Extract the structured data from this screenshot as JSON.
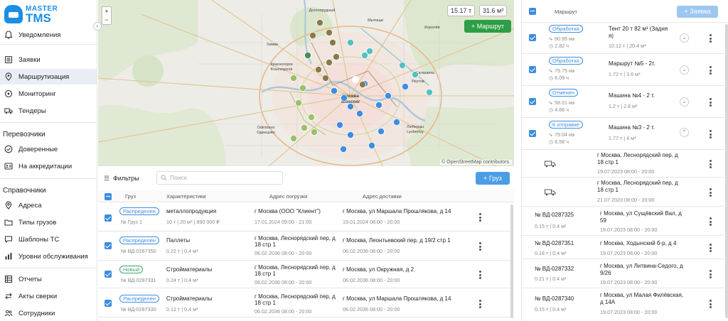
{
  "logo": {
    "line1": "MASTER",
    "line2": "TMS"
  },
  "sidebar": {
    "items": [
      {
        "label": "Уведомления",
        "icon": "bell-icon"
      },
      {
        "label": "Заявки",
        "icon": "list-icon"
      },
      {
        "label": "Маршрутизация",
        "icon": "location-icon"
      },
      {
        "label": "Мониторинг",
        "icon": "target-icon"
      },
      {
        "label": "Тендеры",
        "icon": "truck-icon"
      },
      {
        "label": "Доверенные",
        "icon": "check-circle-icon"
      },
      {
        "label": "На аккредитации",
        "icon": "id-card-icon"
      },
      {
        "label": "Адреса",
        "icon": "pin-icon"
      },
      {
        "label": "Типы грузов",
        "icon": "folder-icon"
      },
      {
        "label": "Шаблоны ТС",
        "icon": "chat-icon"
      },
      {
        "label": "Уровни обслуживания",
        "icon": "bars-icon"
      },
      {
        "label": "Отчеты",
        "icon": "report-icon"
      },
      {
        "label": "Акты сверки",
        "icon": "arrows-icon"
      },
      {
        "label": "Сотрудники",
        "icon": "users-icon"
      }
    ],
    "sections": {
      "carriers": "Перевозчики",
      "references": "Справочники"
    }
  },
  "map": {
    "weight": "15.17 т",
    "volume": "31.6 м³",
    "route_button": "+ Маршрут",
    "zoom_in": "+",
    "zoom_out": "−",
    "attribution": "© OpenStreetMap contributors.",
    "labels": [
      "Долгопрудный",
      "Мытищи",
      "Химки",
      "Королёв",
      "Красногорск",
      "Krasnogorsk",
      "Балашиха",
      "Odintsovo",
      "Одинцово",
      "Люберцы",
      "Lyubertsy",
      "Москва",
      "Moscow",
      "Реутов"
    ]
  },
  "toolbar": {
    "filters": "Фильтры",
    "search_placeholder": "Поиск",
    "add_cargo": "+ Груз"
  },
  "table": {
    "headers": [
      "Груз",
      "Характеристики",
      "Адрес погрузки",
      "Адрес доставки"
    ],
    "rows": [
      {
        "status": "Распределен",
        "id": "№ Груз 1",
        "name": "металлопродукция",
        "specs": "10 т | 20 м³ | 890 000 ₽",
        "load_addr1": "г Москва (ООО \"Клиент\")",
        "load_addr2": "",
        "load_time": "17.01.2024 09:00 - 21:00",
        "del_addr1": "г Москва, ул Маршала Прошлякова, д 14",
        "del_addr2": "",
        "del_time": "19.01.2024 08:00 - 20:00"
      },
      {
        "status": "Распределен",
        "id": "№ ВД-0287350",
        "name": "Паллеты",
        "specs": "0.22 т | 0.4 м³",
        "load_addr1": "г Москва, Леснорядский пер, д",
        "load_addr2": "18 стр 1",
        "load_time": "06.02.2036 08:00 - 20:00",
        "del_addr1": "г Москва, Леонтьевский пер, д 19/2 стр 1",
        "del_addr2": "",
        "del_time": "06.02.2036 08:00 - 20:00"
      },
      {
        "status": "Новый",
        "id": "№ ВД-0287331",
        "name": "Стройматериалы",
        "specs": "0.24 т | 0.4 м³",
        "load_addr1": "г Москва, Леснорядский пер, д",
        "load_addr2": "18 стр 1",
        "load_time": "06.02.2036 08:00 - 20:00",
        "del_addr1": "г Москва, ул Окружная, д 2",
        "del_addr2": "",
        "del_time": "06.02.2036 08:00 - 20:00"
      },
      {
        "status": "Распределен",
        "id": "№ ВД-0287330",
        "name": "Стройматериалы",
        "specs": "0.12 т | 0.4 м³",
        "load_addr1": "г Москва, Леснорядский пер, д",
        "load_addr2": "18 стр 1",
        "load_time": "06.02.2036 08:00 - 20:00",
        "del_addr1": "г Москва, ул Маршала Прошлякова, д 14",
        "del_addr2": "",
        "del_time": "06.02.2036 08:00 - 20:00"
      }
    ]
  },
  "routes_panel": {
    "header": "Маршрут",
    "create_button": "+ Заявка",
    "routes": [
      {
        "status": "Обработка",
        "distance": "90.95 км",
        "duration": "2.82 ч",
        "name1": "Тент 20 т 82 м³ (Задня",
        "name2": "я)",
        "load": "10.12 т | 20.4 м³",
        "chev": "⌄"
      },
      {
        "status": "Обработка",
        "distance": "79.75 км",
        "duration": "6.09 ч",
        "name1": "Маршрут №5 - 2т.",
        "name2": "",
        "load": "1.72 т | 3.6 м³",
        "chev": "⌄"
      },
      {
        "status": "Отменен",
        "distance": "58.01 км",
        "duration": "4.66 ч",
        "name1": "Машина №4 - 2 т.",
        "name2": "",
        "load": "1.2 т | 2.8 м³",
        "chev": "⌄"
      },
      {
        "status": "К отправке",
        "distance": "79.04 км",
        "duration": "6.58 ч",
        "name1": "Машина №3 - 2 т.",
        "name2": "",
        "load": "1.77 т | 4 м³",
        "chev": "⌃"
      }
    ],
    "stops": [
      {
        "addr1": "г Москва, Леснорядский пер, д",
        "addr2": "18 стр 1",
        "time": "19.07.2023 08:00 - 20:00"
      },
      {
        "addr1": "г Москва, Леснорядский пер, д",
        "addr2": "18 стр 1",
        "time": "21.07.2023 08:00 - 20:00"
      }
    ],
    "orders": [
      {
        "id": "№ ВД-0287325",
        "load": "0.15 т | 0.4 м³",
        "addr1": "г Москва, ул Сущёвский Вал, д",
        "addr2": "59",
        "time": "19.07.2023 08:00 - 20:00"
      },
      {
        "id": "№ ВД-0287351",
        "load": "0.18 т | 0.4 м³",
        "addr1": "г Москва, Ходынский б-р, д 4",
        "addr2": "",
        "time": "19.07.2023 08:00 - 20:00"
      },
      {
        "id": "№ ВД-0287332",
        "load": "0.21 т | 0.4 м³",
        "addr1": "г Москва, ул Литвина-Седого, д",
        "addr2": "9/26",
        "time": "19.07.2023 08:00 - 20:00"
      },
      {
        "id": "№ ВД-0287340",
        "load": "0.15 т | 0.4 м³",
        "addr1": "г Москва, ул Малая Филёвская,",
        "addr2": "д 14А",
        "time": "19.07.2023 08:00 - 20:00"
      }
    ]
  },
  "colors": {
    "accent": "#3d8de0",
    "route_green": "#2e9d46",
    "active_bg": "#e9eef5"
  }
}
